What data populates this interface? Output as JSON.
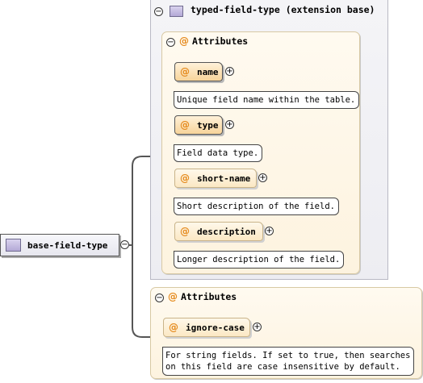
{
  "extension": {
    "title": "typed-field-type (extension base)",
    "attributes_label": "Attributes",
    "attributes": [
      {
        "name": "name",
        "doc": "Unique field name within the table."
      },
      {
        "name": "type",
        "doc": "Field data type."
      },
      {
        "name": "short-name",
        "doc": "Short description of the field."
      },
      {
        "name": "description",
        "doc": "Longer description of the field."
      }
    ]
  },
  "base": {
    "title": "base-field-type"
  },
  "local": {
    "attributes_label": "Attributes",
    "attribute": {
      "name": "ignore-case",
      "doc_line1": "For string fields. If set to true, then searches",
      "doc_line2": "on this field are case insensitive by default."
    }
  },
  "icons": {
    "expand": "plus-circle-icon",
    "collapse": "minus-circle-icon",
    "attribute": "at-sign-icon",
    "complex_type": "type-box-icon"
  },
  "colors": {
    "attribute_accent": "#e58a1d",
    "attribute_fill": "#f7d49a",
    "group_fill": "#fdf3df",
    "type_fill": "#b3a8d6"
  }
}
